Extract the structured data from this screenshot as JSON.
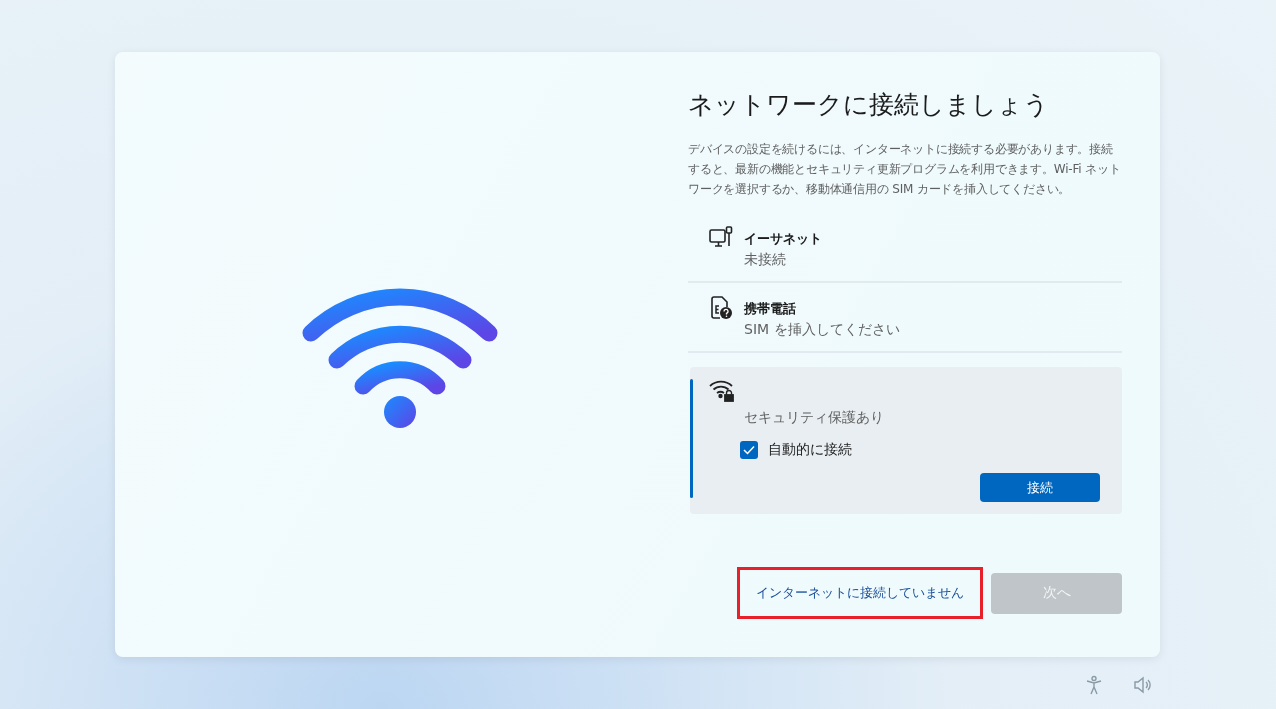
{
  "heading": "ネットワークに接続しましょう",
  "description": "デバイスの設定を続けるには、インターネットに接続する必要があります。接続すると、最新の機能とセキュリティ更新プログラムを利用できます。Wi-Fi ネットワークを選択するか、移動体通信用の SIM カードを挿入してください。",
  "networks": [
    {
      "kind": "ethernet",
      "name": "イーサネット",
      "status": "未接続",
      "selected": false
    },
    {
      "kind": "cellular",
      "name": "携帯電話",
      "status": "SIM を挿入してください",
      "selected": false
    },
    {
      "kind": "wifi",
      "status": "セキュリティ保護あり",
      "selected": true,
      "auto_connect": {
        "label": "自動的に接続",
        "checked": true
      },
      "connect_button": "接続"
    }
  ],
  "footer": {
    "skip_link": {
      "label": "インターネットに接続していません",
      "highlighted": true
    },
    "next_button": {
      "label": "次へ",
      "disabled": true
    }
  }
}
